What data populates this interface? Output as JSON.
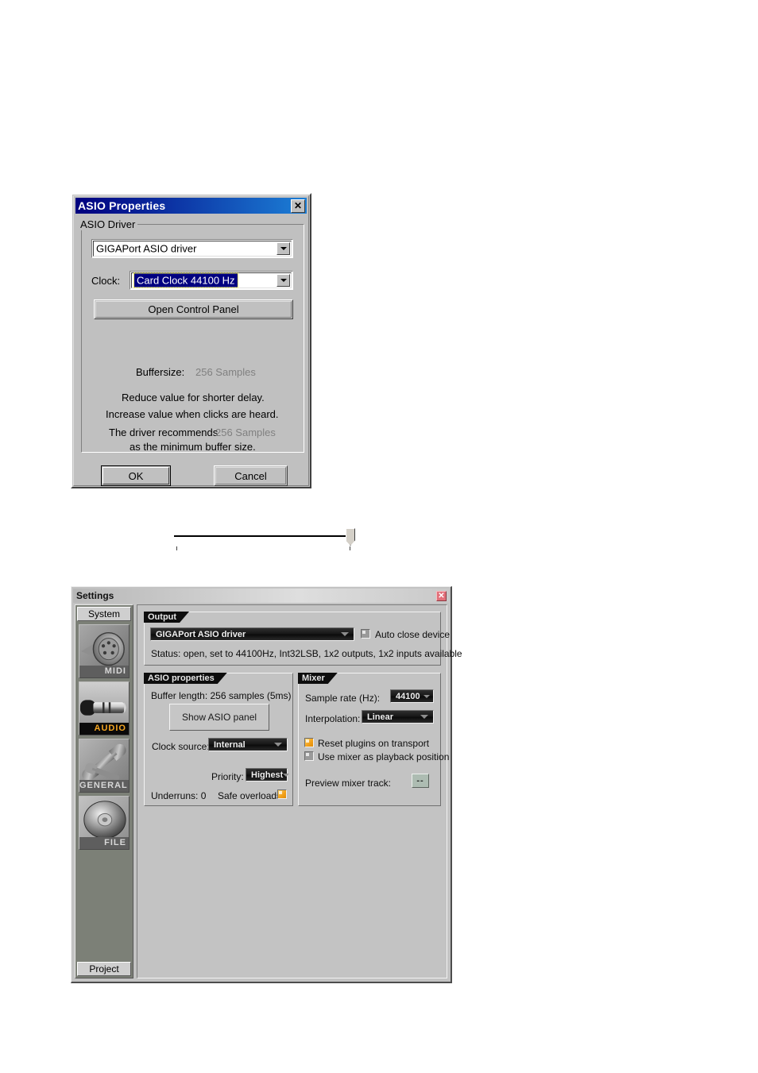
{
  "asio_dialog": {
    "title": "ASIO Properties",
    "close_label": "✕",
    "group_legend": "ASIO Driver",
    "driver_combo": {
      "value": "GIGAPort ASIO driver"
    },
    "clock_label": "Clock:",
    "clock_combo": {
      "value": "Card Clock 44100 Hz"
    },
    "open_control_panel_label": "Open Control Panel",
    "buffersize_label": "Buffersize:",
    "buffersize_value": "256 Samples",
    "hint_line1": "Reduce value for shorter delay.",
    "hint_line2": "Increase value when clicks are heard.",
    "recommend_prefix": "The driver recommends",
    "recommend_value": "256 Samples",
    "recommend_suffix": "as the minimum buffer size.",
    "ok_label": "OK",
    "cancel_label": "Cancel"
  },
  "settings_window": {
    "title": "Settings",
    "close_label": "✕",
    "sidebar": {
      "top_button": "System",
      "bottom_button": "Project",
      "items": [
        {
          "caption": "MIDI",
          "icon": "midi-din-connector-icon",
          "selected": false
        },
        {
          "caption": "AUDIO",
          "icon": "audio-jack-plug-icon",
          "selected": true
        },
        {
          "caption": "GENERAL",
          "icon": "wrench-spanner-icon",
          "selected": false
        },
        {
          "caption": "FILE",
          "icon": "compact-disc-icon",
          "selected": false
        }
      ]
    },
    "output_panel": {
      "tab": "Output",
      "device_combo": {
        "value": "GIGAPort ASIO driver"
      },
      "auto_close_label": "Auto close device",
      "auto_close_checked": false,
      "status": "Status: open, set to 44100Hz, Int32LSB, 1x2 outputs, 1x2 inputs available"
    },
    "asio_panel": {
      "tab": "ASIO properties",
      "buffer_length": "Buffer length: 256 samples (5ms)",
      "show_panel_label": "Show ASIO panel",
      "clock_source_label": "Clock source:",
      "clock_source_value": "Internal",
      "priority_label": "Priority:",
      "priority_value": "Highest",
      "underruns": "Underruns: 0",
      "safe_overloads_label": "Safe overloads",
      "safe_overloads_checked": true
    },
    "mixer_panel": {
      "tab": "Mixer",
      "sample_rate_label": "Sample rate (Hz):",
      "sample_rate_value": "44100",
      "interpolation_label": "Interpolation:",
      "interpolation_value": "Linear",
      "reset_plugins_label": "Reset plugins on transport",
      "reset_plugins_checked": true,
      "use_mixer_label": "Use mixer as playback position",
      "use_mixer_checked": false,
      "preview_track_label": "Preview mixer track:",
      "preview_track_value": "--"
    }
  },
  "colors": {
    "classic_face": "#c0c0c0",
    "title_blue": "#00007e",
    "selection_blue": "#000080",
    "skin_face": "#c3c3c3",
    "accent_orange": "#f3a21c",
    "close_red": "#e2707a"
  }
}
